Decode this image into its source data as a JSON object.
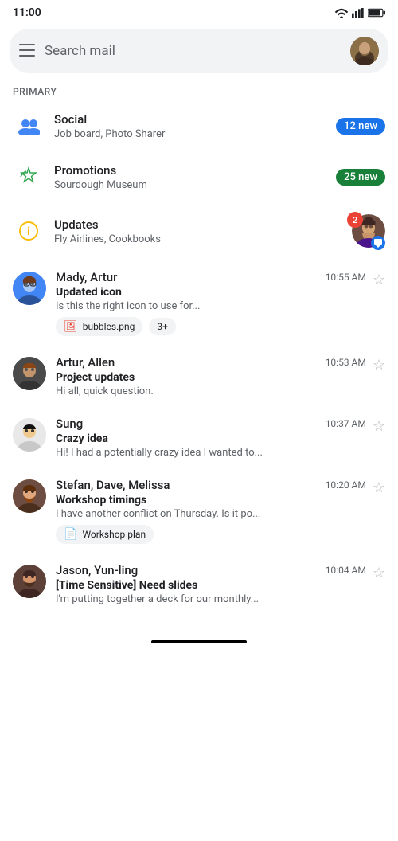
{
  "statusBar": {
    "time": "11:00",
    "wifi": true,
    "signal": true,
    "battery": true
  },
  "searchBar": {
    "placeholder": "Search mail"
  },
  "sectionLabel": "PRIMARY",
  "categories": [
    {
      "id": "social",
      "name": "Social",
      "sub": "Job board, Photo Sharer",
      "badge": "12 new",
      "badgeType": "blue"
    },
    {
      "id": "promotions",
      "name": "Promotions",
      "sub": "Sourdough Museum",
      "badge": "25 new",
      "badgeType": "green"
    },
    {
      "id": "updates",
      "name": "Updates",
      "sub": "Fly Airlines, Cookbooks",
      "badge": "2",
      "badgeType": "updates"
    }
  ],
  "emails": [
    {
      "id": "email1",
      "sender": "Mady, Artur",
      "time": "10:55 AM",
      "subject": "Updated icon",
      "preview": "Is this the right icon to use for...",
      "avatarColor": "#4285f4",
      "avatarType": "person",
      "starred": false,
      "attachments": [
        "bubbles.png"
      ],
      "more": "3+"
    },
    {
      "id": "email2",
      "sender": "Artur, Allen",
      "time": "10:53 AM",
      "subject": "Project updates",
      "preview": "Hi all, quick question.",
      "avatarColor": "#555",
      "avatarType": "person2",
      "starred": false,
      "attachments": [],
      "more": ""
    },
    {
      "id": "email3",
      "sender": "Sung",
      "time": "10:37 AM",
      "subject": "Crazy idea",
      "preview": "Hi! I had a potentially crazy idea I wanted to...",
      "avatarColor": "#e0e0e0",
      "avatarType": "person3",
      "starred": false,
      "attachments": [],
      "more": ""
    },
    {
      "id": "email4",
      "sender": "Stefan, Dave, Melissa",
      "time": "10:20 AM",
      "subject": "Workshop timings",
      "preview": "I have another conflict on Thursday. Is it po...",
      "avatarColor": "#8b4513",
      "avatarType": "person4",
      "starred": false,
      "attachments": [
        "Workshop plan"
      ],
      "more": ""
    },
    {
      "id": "email5",
      "sender": "Jason, Yun-ling",
      "time": "10:04 AM",
      "subject": "[Time Sensitive] Need slides",
      "preview": "I'm putting together a deck for our monthly...",
      "avatarColor": "#5d4037",
      "avatarType": "person5",
      "starred": false,
      "attachments": [],
      "more": ""
    }
  ]
}
